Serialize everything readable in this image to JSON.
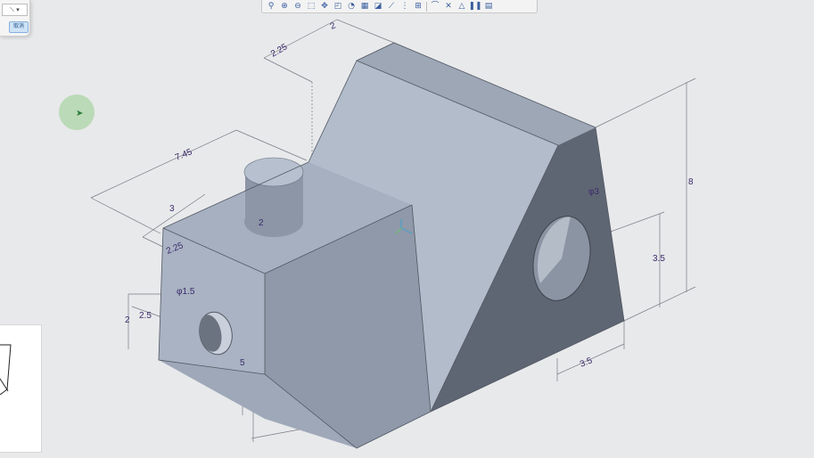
{
  "toolbar": {
    "icons": [
      "zoom-icon",
      "zoom-in-icon",
      "zoom-out-icon",
      "refit-icon",
      "pan-icon",
      "view-orientation-icon",
      "appearance-icon",
      "display-style-icon",
      "saved-views-icon",
      "perspective-icon",
      "datum-display-icon",
      "annotation-icon",
      "section-icon",
      "spin-center-icon",
      "drawing-icon",
      "pause-icon",
      "more-icon"
    ],
    "glyphs": [
      "⚲",
      "⊕",
      "⊖",
      "⬚",
      "✥",
      "◰",
      "◔",
      "▦",
      "◪",
      "⟋",
      "⋮",
      "⊞",
      "⌒",
      "✕",
      "△",
      "❚❚",
      "▤"
    ]
  },
  "dialog": {
    "dropdown_value": "⟍ ▾",
    "cancel_label": "取消"
  },
  "dimensions": {
    "d_2_top": "2",
    "d_2_25_top": "2.25",
    "d_7_45": "7.45",
    "d_3": "3",
    "d_2_boss": "2",
    "d_2_25_left": "2.25",
    "d_phi_1_5": "φ1.5",
    "d_2_5": "2.5",
    "d_2_left": "2",
    "d_5": "5",
    "d_phi_3": "φ3",
    "d_8": "8",
    "d_3_5_right": "3.5",
    "d_3_5_bottom": "3.5"
  },
  "colors": {
    "background": "#e8e9eb",
    "face_light": "#b2bccb",
    "face_mid": "#97a1b1",
    "face_dark": "#5f6673",
    "dimension_text": "#3b2a6b",
    "cursor_halo": "#96cd8c"
  }
}
